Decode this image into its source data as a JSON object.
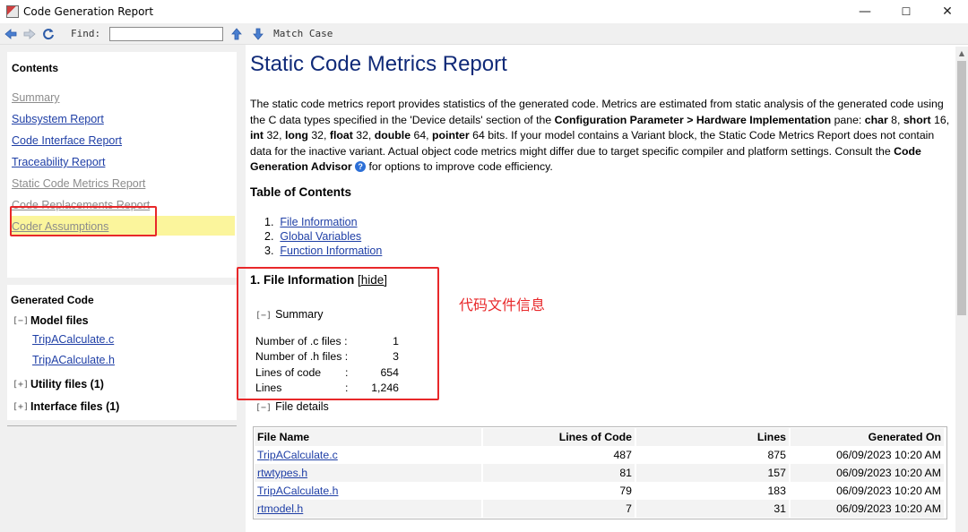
{
  "window": {
    "title": "Code Generation Report",
    "minimize": "—",
    "maximize": "☐",
    "close": "✕"
  },
  "toolbar": {
    "back_icon": "back-arrow-icon",
    "forward_icon": "forward-arrow-icon",
    "refresh_icon": "refresh-icon",
    "find_label": "Find:",
    "find_value": "",
    "up_icon": "find-previous-icon",
    "down_icon": "find-next-icon",
    "match_case": "Match Case"
  },
  "sidebar": {
    "contents_title": "Contents",
    "items": [
      {
        "label": "Summary",
        "state": "visited"
      },
      {
        "label": "Subsystem Report",
        "state": "link"
      },
      {
        "label": "Code Interface Report",
        "state": "link"
      },
      {
        "label": "Traceability Report",
        "state": "link"
      },
      {
        "label": "Static Code Metrics Report",
        "state": "selected"
      },
      {
        "label": "Code Replacements Report",
        "state": "visited"
      },
      {
        "label": "Coder Assumptions",
        "state": "visited"
      }
    ],
    "generated_code_title": "Generated Code",
    "model_files": {
      "toggle": "[−]",
      "label": "Model files",
      "files": [
        "TripACalculate.c",
        "TripACalculate.h"
      ]
    },
    "utility_files": {
      "toggle": "[+]",
      "label": "Utility files (1)"
    },
    "interface_files": {
      "toggle": "[+]",
      "label": "Interface files (1)"
    }
  },
  "report": {
    "title": "Static Code Metrics Report",
    "intro_1": "The static code metrics report provides statistics of the generated code. Metrics are estimated from static analysis of the generated code using the C data types specified in the 'Device details' section of the ",
    "intro_bold_1": "Configuration Parameter > Hardware Implementation",
    "intro_2": " pane: ",
    "intro_char": "char",
    "intro_char_v": " 8, ",
    "intro_short": "short",
    "intro_short_v": " 16, ",
    "intro_int": "int",
    "intro_int_v": " 32, ",
    "intro_long": "long",
    "intro_long_v": " 32, ",
    "intro_float": "float",
    "intro_float_v": " 32, ",
    "intro_double": "double",
    "intro_double_v": " 64, ",
    "intro_pointer": "pointer",
    "intro_3": " 64 bits. If your model contains a Variant block, the Static Code Metrics Report does not contain data for the inactive variant. Actual object code metrics might differ due to target specific compiler and platform settings. Consult the ",
    "intro_bold_2": "Code Generation Advisor",
    "help_icon": "?",
    "intro_4": " for options to improve code efficiency.",
    "toc_title": "Table of Contents",
    "toc": [
      {
        "num": "1.",
        "label": "File Information"
      },
      {
        "num": "2.",
        "label": "Global Variables"
      },
      {
        "num": "3.",
        "label": "Function Information"
      }
    ],
    "file_info": {
      "title": "1. File Information",
      "hide": "[hide]",
      "summary_toggle": "[−]",
      "summary_label": "Summary",
      "summary_rows": [
        {
          "key": "Number of .c files :",
          "sep": "",
          "value": "1"
        },
        {
          "key": "Number of .h files :",
          "sep": "",
          "value": "3"
        },
        {
          "key": "Lines of code",
          "sep": ":",
          "value": "654"
        },
        {
          "key": "Lines",
          "sep": ":",
          "value": "1,246"
        }
      ],
      "details_toggle": "[−]",
      "details_label": "File details",
      "annotation": "代码文件信息",
      "table": {
        "headers": [
          "File Name",
          "Lines of Code",
          "Lines",
          "Generated On"
        ],
        "rows": [
          [
            "TripACalculate.c",
            "487",
            "875",
            "06/09/2023 10:20 AM"
          ],
          [
            "rtwtypes.h",
            "81",
            "157",
            "06/09/2023 10:20 AM"
          ],
          [
            "TripACalculate.h",
            "79",
            "183",
            "06/09/2023 10:20 AM"
          ],
          [
            "rtmodel.h",
            "7",
            "31",
            "06/09/2023 10:20 AM"
          ]
        ]
      }
    }
  },
  "colors": {
    "link": "#1f3fa6",
    "visited": "#8c8c8c",
    "title": "#102a78",
    "highlight": "#fbf59c",
    "annotation_red": "#e8282a"
  }
}
